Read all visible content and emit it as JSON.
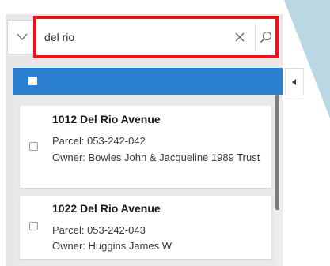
{
  "search": {
    "value": "del rio",
    "placeholder": ""
  },
  "results": [
    {
      "title": "1012 Del Rio Avenue",
      "parcel": "Parcel: 053-242-042",
      "owner": "Owner: Bowles John & Jacqueline 1989 Trust"
    },
    {
      "title": "1022 Del Rio Avenue",
      "parcel": "Parcel: 053-242-043",
      "owner": "Owner: Huggins James W"
    }
  ],
  "icons": {
    "dropdown": "chevron-down-icon",
    "clear": "close-icon",
    "search": "search-icon",
    "collapse": "chevron-left-icon"
  },
  "colors": {
    "header_blue": "#2b7fd1",
    "highlight_red": "#e8131b",
    "map_blue": "#b9d8e3"
  }
}
